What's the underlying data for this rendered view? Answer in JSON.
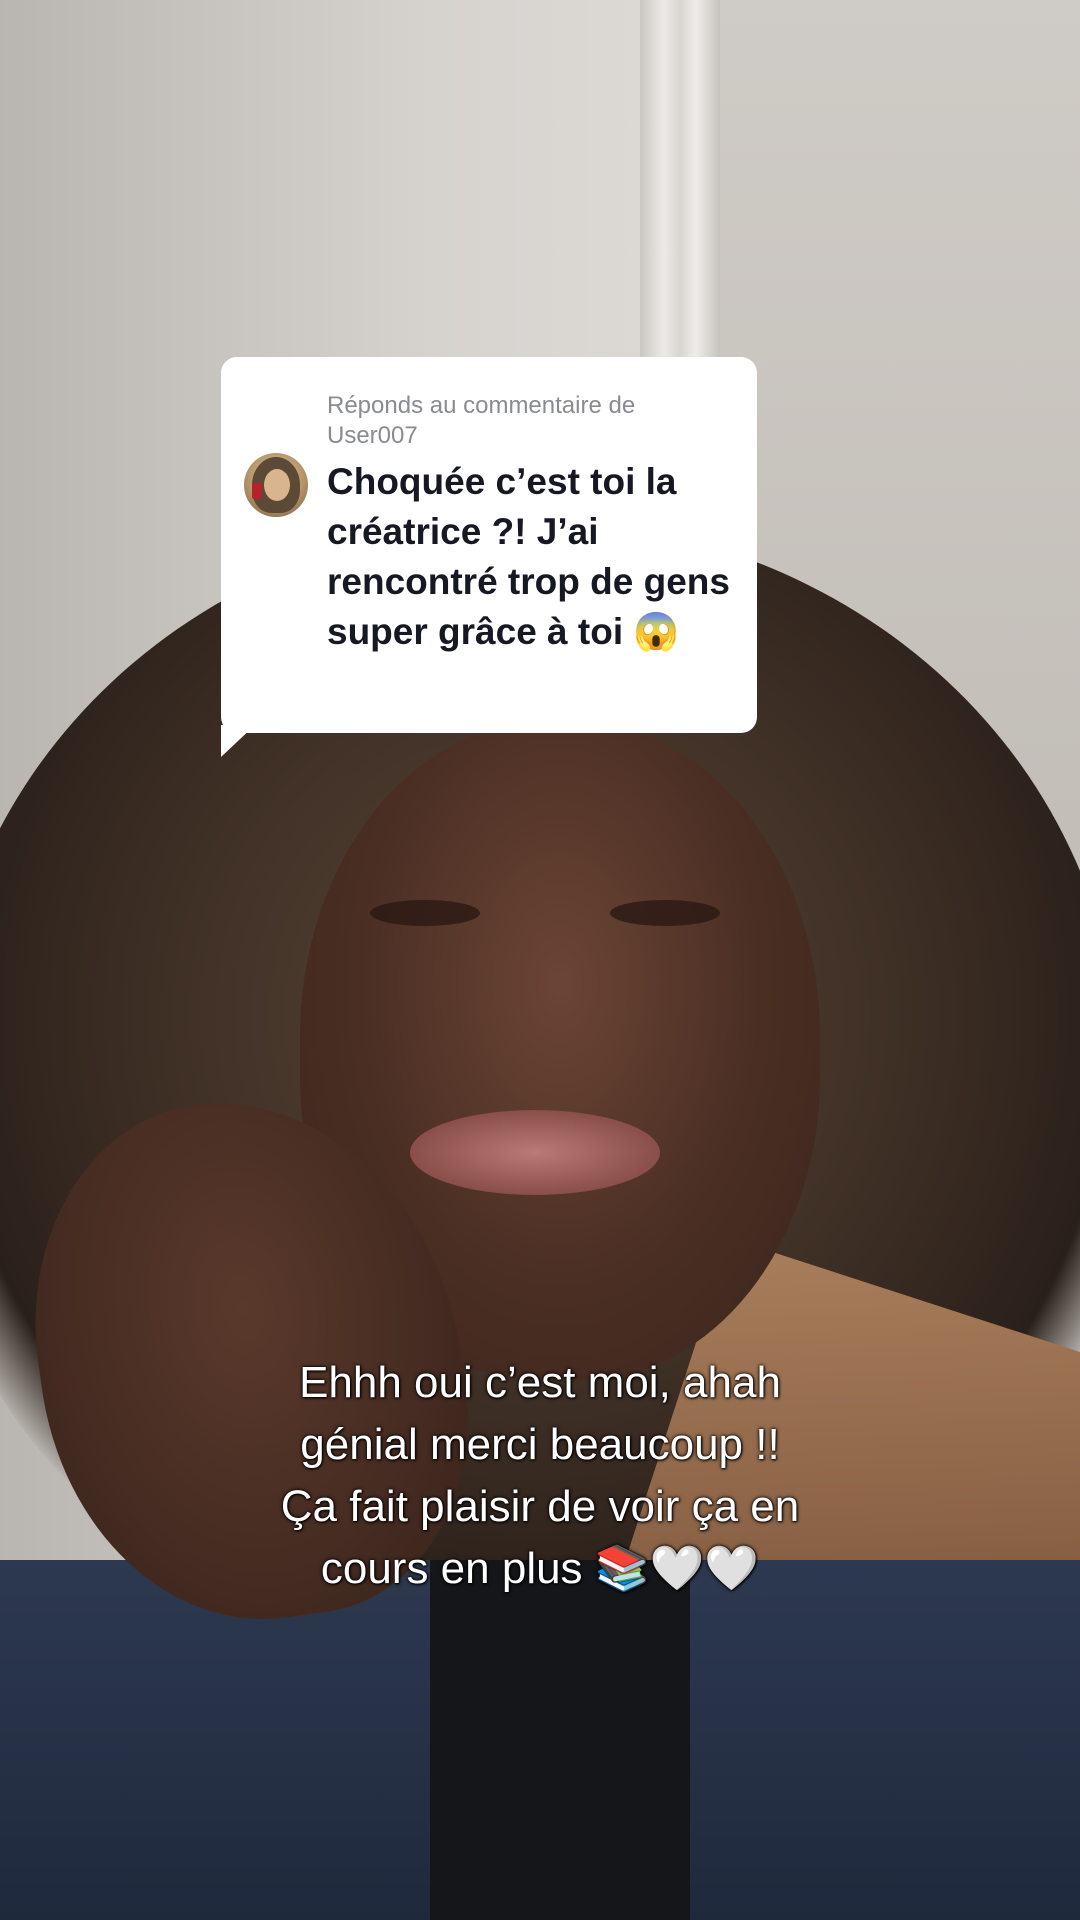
{
  "reply": {
    "header_prefix": "Réponds au commentaire de",
    "username": "User007",
    "comment": "Choquée c’est toi la créatrice ?! J’ai rencontré trop de gens super grâce à toi 😱"
  },
  "caption": {
    "lines": [
      "Ehhh oui c’est moi, ahah",
      "génial merci beaucoup !!",
      "Ça fait plaisir de voir ça en",
      "cours en plus 📚🤍🤍"
    ]
  }
}
